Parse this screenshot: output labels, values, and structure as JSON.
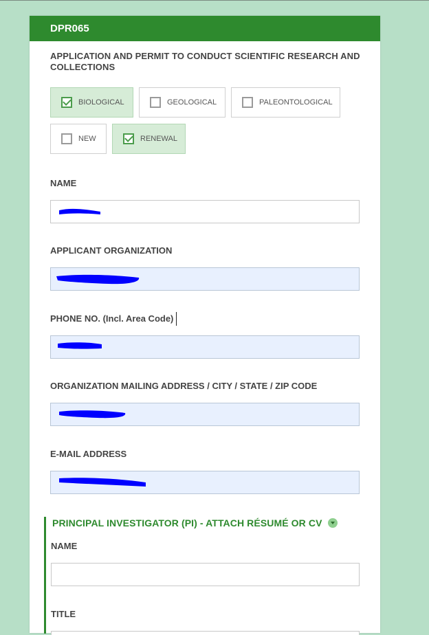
{
  "form": {
    "code": "DPR065",
    "title": "APPLICATION AND PERMIT TO CONDUCT SCIENTIFIC RESEARCH AND COLLECTIONS",
    "options": {
      "biological": {
        "label": "BIOLOGICAL",
        "checked": true
      },
      "geological": {
        "label": "GEOLOGICAL",
        "checked": false
      },
      "paleontological": {
        "label": "PALEONTOLOGICAL",
        "checked": false
      },
      "new": {
        "label": "NEW",
        "checked": false
      },
      "renewal": {
        "label": "RENEWAL",
        "checked": true
      }
    },
    "fields": {
      "name": {
        "label": "NAME"
      },
      "organization": {
        "label": "APPLICANT ORGANIZATION"
      },
      "phone": {
        "label": "PHONE NO. (Incl. Area Code)"
      },
      "address": {
        "label": "ORGANIZATION MAILING ADDRESS / CITY / STATE / ZIP CODE"
      },
      "email": {
        "label": "E-MAIL ADDRESS"
      }
    },
    "pi_section": {
      "title": "PRINCIPAL INVESTIGATOR (PI) - ATTACH RÉSUMÉ OR CV",
      "name_label": "NAME",
      "title_label": "TITLE"
    }
  },
  "colors": {
    "page_background": "#b7dfc7",
    "header_green": "#2e8a2e",
    "checked_option_bg": "#d6ecd7",
    "autofill_field_bg": "#e8f0fe",
    "redaction_blue": "#0000ff"
  },
  "icons": [
    "check-icon",
    "chevron-down-icon"
  ]
}
